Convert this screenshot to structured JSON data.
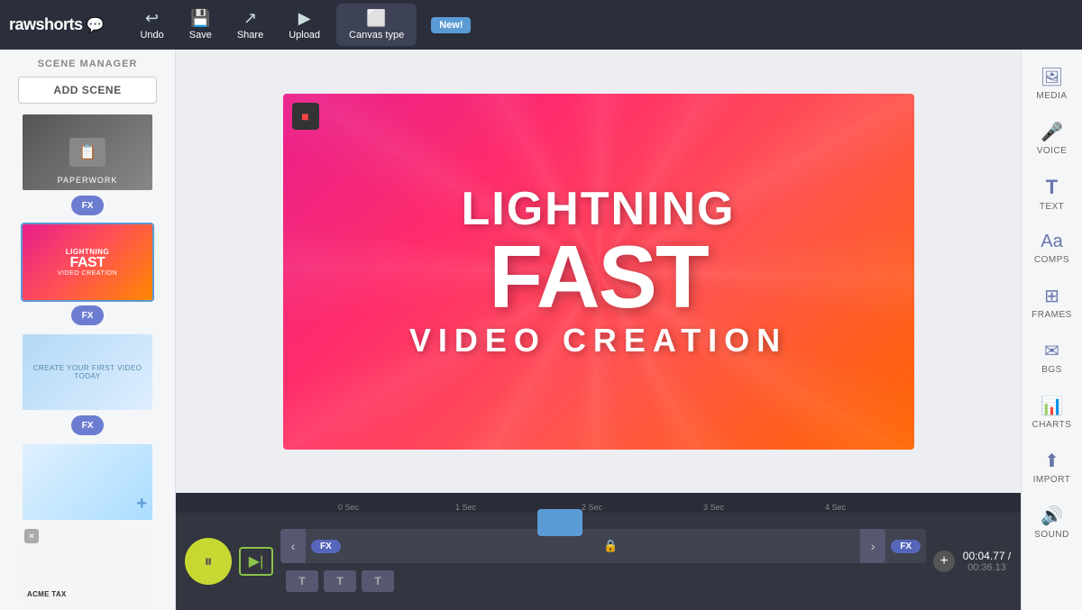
{
  "app": {
    "logo": "rawshorts",
    "logo_icon": "💬"
  },
  "toolbar": {
    "undo_label": "Undo",
    "save_label": "Save",
    "share_label": "Share",
    "upload_label": "Upload",
    "canvas_type_label": "Canvas type",
    "new_badge": "New!"
  },
  "left_sidebar": {
    "title": "SCENE MANAGER",
    "add_scene_label": "ADD SCENE",
    "scenes": [
      {
        "id": 1,
        "type": "paperwork",
        "label": "PAPERWORK",
        "active": false
      },
      {
        "id": 2,
        "type": "lightning",
        "label": "Lightning Fast Video Creation",
        "active": true
      },
      {
        "id": 3,
        "type": "blue-abstract",
        "label": "CREATE YOUR FIRST VIDEO TODAY",
        "active": false
      },
      {
        "id": 4,
        "type": "blue2",
        "label": "",
        "active": false
      },
      {
        "id": 5,
        "type": "acme",
        "label": "ACME TAX",
        "active": false
      }
    ],
    "fx_label": "FX"
  },
  "canvas": {
    "text_lightning": "LIGHTNING",
    "text_fast": "FAST",
    "text_creation": "VIDEO CREATION"
  },
  "timeline": {
    "ruler_marks": [
      "0 Sec",
      "1 Sec",
      "2 Sec",
      "3 Sec",
      "4 Sec"
    ],
    "current_time": "00:04.77 /",
    "total_time": "00:36.13",
    "fx_label": "FX",
    "text_blocks": [
      "T",
      "T",
      "T"
    ]
  },
  "right_sidebar": {
    "tools": [
      {
        "id": "media",
        "icon": "🖼",
        "label": "MEDIA"
      },
      {
        "id": "voice",
        "icon": "🎤",
        "label": "VOICE"
      },
      {
        "id": "text",
        "icon": "T",
        "label": "TEXT"
      },
      {
        "id": "comps",
        "icon": "Aa",
        "label": "COMPS"
      },
      {
        "id": "frames",
        "icon": "➕",
        "label": "FRAMES"
      },
      {
        "id": "bgs",
        "icon": "✉",
        "label": "BGs"
      },
      {
        "id": "charts",
        "icon": "📊",
        "label": "CHARTS"
      },
      {
        "id": "import",
        "icon": "⬆",
        "label": "IMPORT"
      },
      {
        "id": "sound",
        "icon": "🔊",
        "label": "SOUND"
      }
    ]
  }
}
